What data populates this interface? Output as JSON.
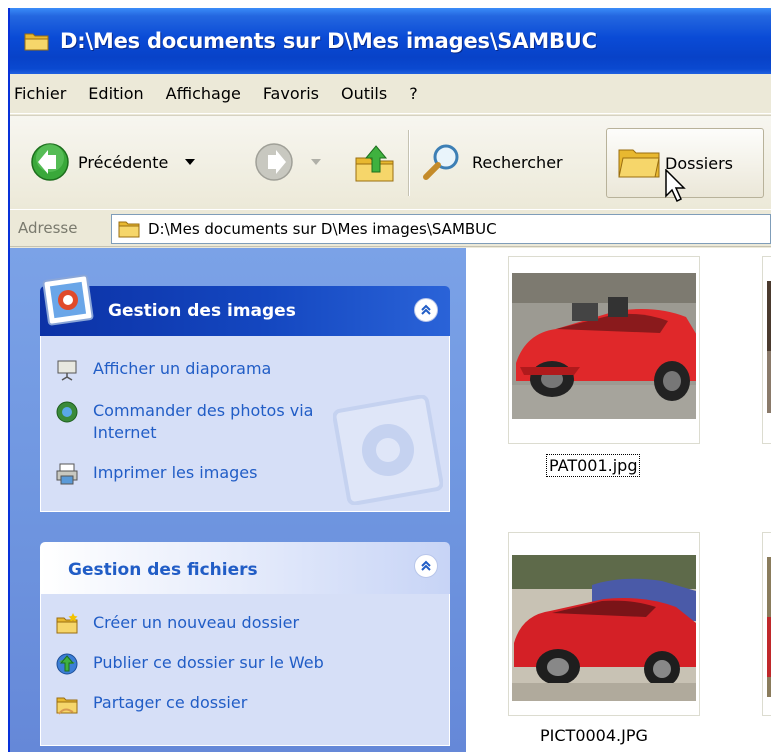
{
  "window": {
    "title": "D:\\Mes documents sur D\\Mes images\\SAMBUC"
  },
  "menu": [
    {
      "label": "Fichier"
    },
    {
      "label": "Edition"
    },
    {
      "label": "Affichage"
    },
    {
      "label": "Favoris"
    },
    {
      "label": "Outils"
    },
    {
      "label": "?"
    }
  ],
  "toolbar": {
    "back_label": "Précédente",
    "search_label": "Rechercher",
    "folders_label": "Dossiers"
  },
  "address": {
    "label": "Adresse",
    "value": "D:\\Mes documents sur D\\Mes images\\SAMBUC"
  },
  "panes": {
    "images": {
      "title": "Gestion des images",
      "tasks": [
        {
          "label": "Afficher un diaporama",
          "icon": "slideshow-icon"
        },
        {
          "label": "Commander des photos via Internet",
          "icon": "order-prints-icon"
        },
        {
          "label": "Imprimer les images",
          "icon": "print-icon"
        }
      ]
    },
    "files": {
      "title": "Gestion des fichiers",
      "tasks": [
        {
          "label": "Créer un nouveau dossier",
          "icon": "new-folder-icon"
        },
        {
          "label": "Publier ce dossier sur le Web",
          "icon": "publish-web-icon"
        },
        {
          "label": "Partager ce dossier",
          "icon": "share-folder-icon"
        }
      ]
    }
  },
  "files": [
    {
      "name": "PAT001.jpg",
      "selected": true
    },
    {
      "name": "PICT0004.JPG",
      "selected": false
    }
  ],
  "colors": {
    "titlebar": "#0a4bd6",
    "taskpane": "#7ba2e7",
    "link": "#215dc6"
  }
}
